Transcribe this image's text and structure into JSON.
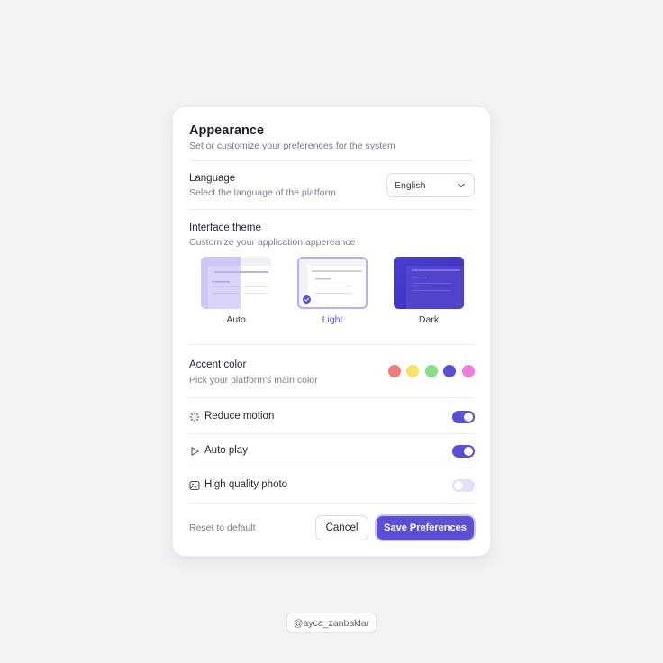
{
  "appearance": {
    "title": "Appearance",
    "subtitle": "Set or customize your preferences for the system"
  },
  "language": {
    "title": "Language",
    "subtitle": "Select the language of the platform",
    "selected": "English",
    "icon": "chevron-down-icon"
  },
  "theme": {
    "title": "Interface theme",
    "subtitle": "Customize your application appereance",
    "options": [
      {
        "label": "Auto",
        "selected": false
      },
      {
        "label": "Light",
        "selected": true
      },
      {
        "label": "Dark",
        "selected": false
      }
    ]
  },
  "accent": {
    "title": "Accent color",
    "subtitle": "Pick your platform's main color",
    "colors": [
      "#f47a7a",
      "#f7e26a",
      "#86df8b",
      "#5b4fd6",
      "#ef7fd8"
    ],
    "selected_index": 3
  },
  "settings": [
    {
      "label": "Reduce motion",
      "icon": "loader-icon",
      "enabled": true
    },
    {
      "label": "Auto play",
      "icon": "play-icon",
      "enabled": true
    },
    {
      "label": "High quality photo",
      "icon": "photo-icon",
      "enabled": false
    }
  ],
  "footer": {
    "reset_label": "Reset to default",
    "cancel_label": "Cancel",
    "save_label": "Save Preferences"
  },
  "credit": "@ayca_zanbaklar",
  "colors": {
    "accent": "#5b4fd6",
    "toggle_off": "#e3e0fa"
  }
}
